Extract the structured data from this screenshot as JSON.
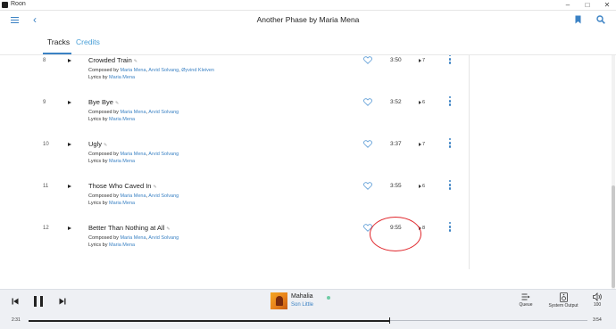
{
  "window": {
    "app_title": "Roon"
  },
  "header": {
    "title": "Another Phase by Maria Mena"
  },
  "tabs": [
    {
      "label": "Tracks",
      "active": true
    },
    {
      "label": "Credits",
      "active": false
    }
  ],
  "tracks": [
    {
      "number": "8",
      "title": "Crowded Train",
      "composed_label": "Composed by ",
      "composers": [
        "Maria Mena",
        "Arvid Solvang",
        "Øyvind Kleiven"
      ],
      "lyrics_label": "Lyrics by ",
      "lyricists": [
        "Maria Mena"
      ],
      "duration": "3:50",
      "plays": "7"
    },
    {
      "number": "9",
      "title": "Bye Bye",
      "composed_label": "Composed by ",
      "composers": [
        "Maria Mena",
        "Arvid Solvang"
      ],
      "lyrics_label": "Lyrics by ",
      "lyricists": [
        "Maria Mena"
      ],
      "duration": "3:52",
      "plays": "6"
    },
    {
      "number": "10",
      "title": "Ugly",
      "composed_label": "Composed by ",
      "composers": [
        "Maria Mena",
        "Arvid Solvang"
      ],
      "lyrics_label": "Lyrics by ",
      "lyricists": [
        "Maria Mena"
      ],
      "duration": "3:37",
      "plays": "7"
    },
    {
      "number": "11",
      "title": "Those Who Caved In",
      "composed_label": "Composed by ",
      "composers": [
        "Maria Mena",
        "Arvid Solvang"
      ],
      "lyrics_label": "Lyrics by ",
      "lyricists": [
        "Maria Mena"
      ],
      "duration": "3:55",
      "plays": "6"
    },
    {
      "number": "12",
      "title": "Better Than Nothing at All",
      "composed_label": "Composed by ",
      "composers": [
        "Maria Mena",
        "Arvid Solvang"
      ],
      "lyrics_label": "Lyrics by ",
      "lyricists": [
        "Maria Mena"
      ],
      "duration": "9:55",
      "plays": "8"
    }
  ],
  "now_playing": {
    "title": "Mahalia",
    "artist": "Son Little",
    "elapsed": "2:31",
    "total": "3:54",
    "progress_fraction": 0.645
  },
  "controls": {
    "queue_label": "Queue",
    "system_output_label": "System Output",
    "volume": "100"
  },
  "icons": {
    "menu": "hamburger-icon",
    "back": "chevron-left-icon",
    "bookmark": "bookmark-icon",
    "search": "search-icon",
    "favorite": "heart-outline-icon",
    "more": "vertical-dots-icon",
    "queue": "queue-icon",
    "output": "speaker-device-icon",
    "volume": "volume-icon"
  },
  "colors": {
    "accent": "#3b82c4",
    "annotation": "#e0262b",
    "player_bg": "#eef0f4"
  }
}
